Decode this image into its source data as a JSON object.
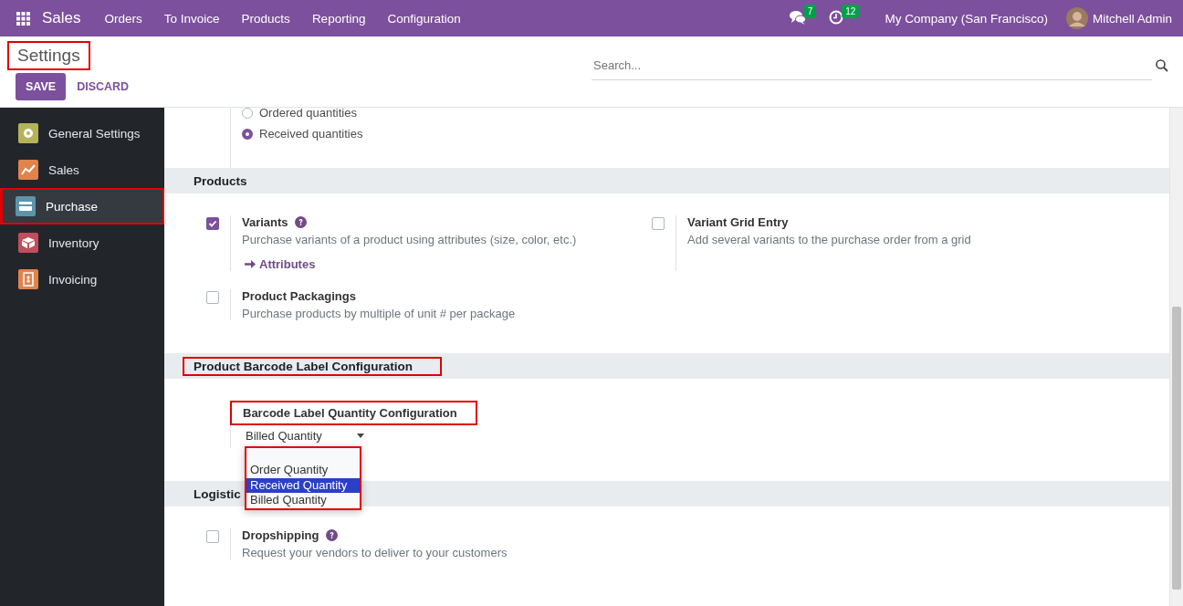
{
  "topbar": {
    "app": "Sales",
    "menu": [
      "Orders",
      "To Invoice",
      "Products",
      "Reporting",
      "Configuration"
    ],
    "messages_badge": "7",
    "activities_badge": "12",
    "company": "My Company (San Francisco)",
    "user": "Mitchell Admin"
  },
  "control_panel": {
    "breadcrumb": "Settings",
    "breadcrumb_annotated": true,
    "search": {
      "placeholder": "Search..."
    },
    "buttons": [
      "SAVE",
      "DISCARD"
    ]
  },
  "sidebar": {
    "items": [
      {
        "label": "General Settings",
        "color": "#b5b35a",
        "selected": false,
        "annotated": false
      },
      {
        "label": "Sales",
        "color": "#e0834c",
        "selected": false,
        "annotated": false
      },
      {
        "label": "Purchase",
        "color": "#5d95a8",
        "selected": true,
        "annotated": true
      },
      {
        "label": "Inventory",
        "color": "#c24d5c",
        "selected": false,
        "annotated": false
      },
      {
        "label": "Invoicing",
        "color": "#e0834c",
        "selected": false,
        "annotated": false
      }
    ]
  },
  "radio_options": [
    {
      "label": "Ordered quantities",
      "selected": false
    },
    {
      "label": "Received quantities",
      "selected": true
    }
  ],
  "sections": [
    {
      "title": "Products",
      "annotated": false,
      "settings": [
        {
          "kind": "checkbox",
          "title": "Variants",
          "checked": true,
          "help": true,
          "description": "Purchase variants of a product using attributes (size, color, etc.)",
          "link": "Attributes"
        },
        {
          "kind": "checkbox",
          "title": "Variant Grid Entry",
          "checked": false,
          "help": false,
          "description": "Add several variants to the purchase order from a grid"
        },
        {
          "kind": "checkbox",
          "title": "Product Packagings",
          "checked": false,
          "help": false,
          "description": "Purchase products by multiple of unit # per package"
        }
      ]
    },
    {
      "title": "Product Barcode Label Configuration",
      "annotated": true,
      "settings": [
        {
          "kind": "select",
          "title": "Barcode Label Quantity Configuration",
          "annotated": true,
          "value": "Billed Quantity",
          "dropdown": {
            "annotated": true,
            "options": [
              {
                "label": "Order Quantity",
                "selected": false
              },
              {
                "label": "Received Quantity",
                "selected": true
              },
              {
                "label": "Billed Quantity",
                "selected": false
              }
            ]
          }
        }
      ]
    },
    {
      "title": "Logistic",
      "annotated": false,
      "settings": [
        {
          "kind": "checkbox",
          "title": "Dropshipping",
          "checked": false,
          "help": true,
          "description": "Request your vendors to deliver to your customers"
        }
      ]
    }
  ]
}
